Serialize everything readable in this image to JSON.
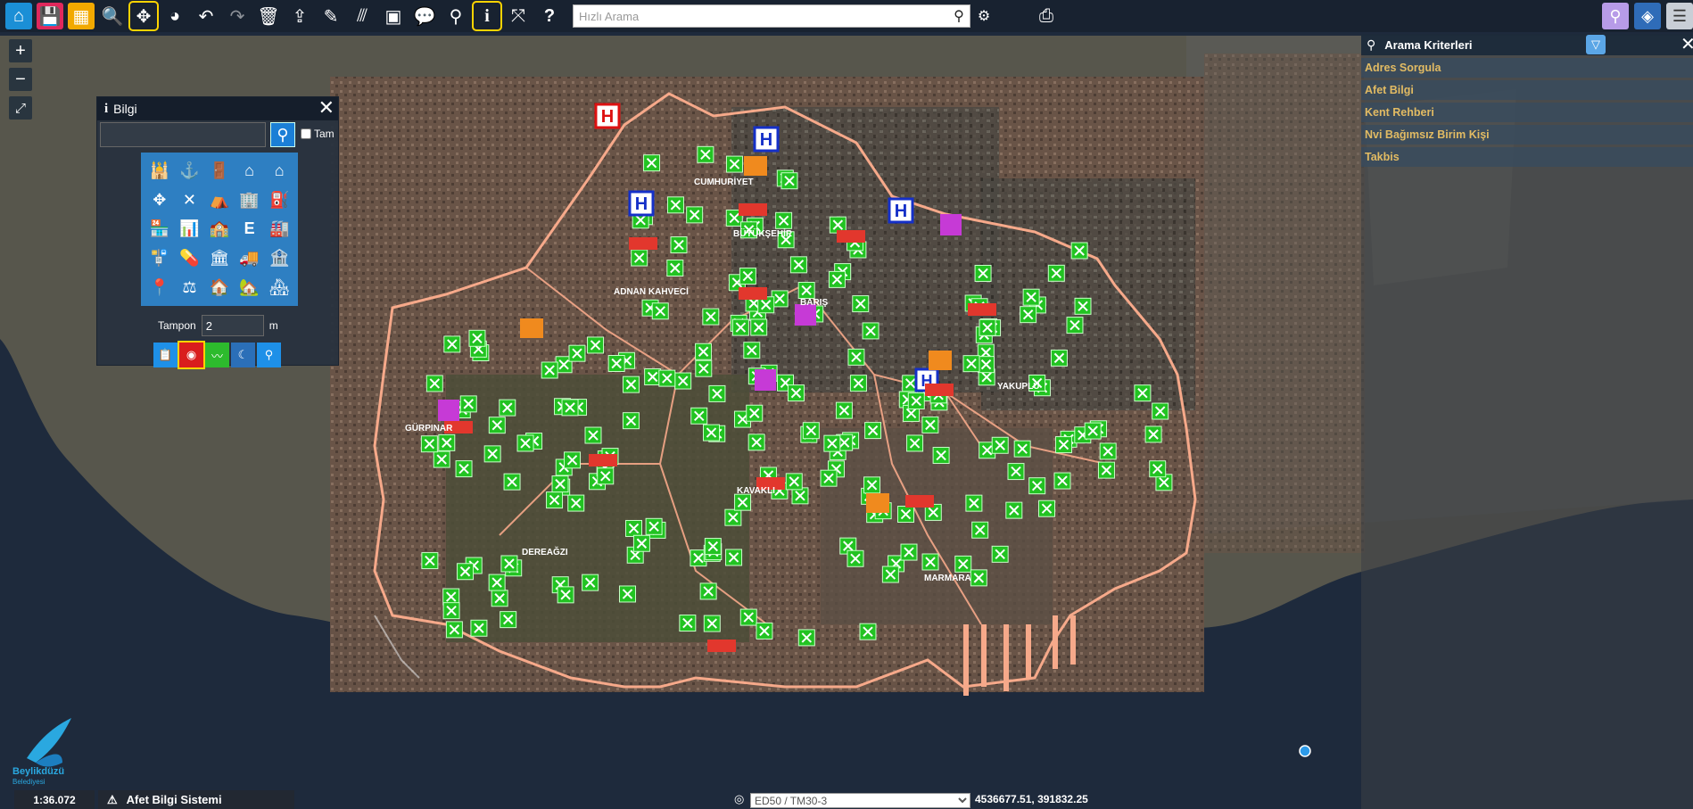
{
  "toolbar": {
    "search_placeholder": "Hızlı Arama"
  },
  "bilgi_panel": {
    "title": "Bilgi",
    "checkbox_label": "Tam",
    "tampon_label": "Tampon",
    "tampon_value": "2",
    "tampon_unit": "m"
  },
  "right_panel": {
    "title": "Arama Kriterleri",
    "items": [
      "Adres Sorgula",
      "Afet Bilgi",
      "Kent Rehberi",
      "Nvi Bağımsız Birim Kişi",
      "Takbis"
    ]
  },
  "map": {
    "labels": [
      "CUMHURİYET",
      "BARIŞ",
      "ADNAN KAHVECİ",
      "BÜYÜKŞEHİR",
      "GÜRPINAR",
      "DEREAĞZI",
      "KAVAKLI",
      "YAKUPLU",
      "MARMARA"
    ],
    "colors": {
      "boundary": "#f6a98a",
      "green_marker": "#22c322",
      "hospital": "#1530c8"
    }
  },
  "bottom_bar": {
    "scale": "1:36.072",
    "app_name": "Afet Bilgi Sistemi",
    "crs_selected": "ED50 / TM30-3",
    "coordinates": "4536677.51, 391832.25"
  },
  "logo": {
    "line1": "Beylikdüzü",
    "line2": "Belediyesi"
  }
}
